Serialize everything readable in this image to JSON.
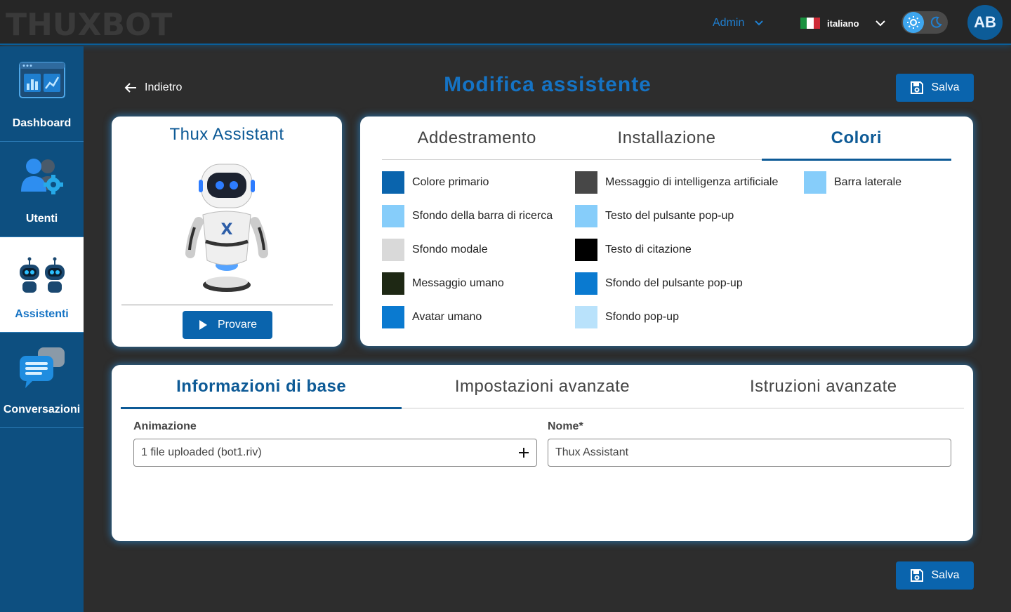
{
  "header": {
    "logo_text": "THUXBOT",
    "admin_label": "Admin",
    "language_label": "italiano",
    "avatar_initials": "AB"
  },
  "sidebar": {
    "items": [
      {
        "label": "Dashboard",
        "icon": "dashboard-chart-icon",
        "active": false
      },
      {
        "label": "Utenti",
        "icon": "users-gear-icon",
        "active": false
      },
      {
        "label": "Assistenti",
        "icon": "robots-icon",
        "active": true
      },
      {
        "label": "Conversazioni",
        "icon": "chat-bubbles-icon",
        "active": false
      }
    ]
  },
  "page": {
    "back_label": "Indietro",
    "title": "Modifica assistente",
    "save_label": "Salva"
  },
  "bot_card": {
    "name": "Thux Assistant",
    "try_label": "Provare"
  },
  "top_tabs": {
    "items": [
      {
        "label": "Addestramento",
        "active": false
      },
      {
        "label": "Installazione",
        "active": false
      },
      {
        "label": "Colori",
        "active": true
      }
    ]
  },
  "colors": {
    "items": [
      {
        "label": "Colore primario",
        "color": "#0a64ad"
      },
      {
        "label": "Sfondo della barra di ricerca",
        "color": "#86cdfa"
      },
      {
        "label": "Sfondo modale",
        "color": "#d9d9d9"
      },
      {
        "label": "Messaggio umano",
        "color": "#1e2814"
      },
      {
        "label": "Avatar umano",
        "color": "#0a7ad0"
      },
      {
        "label": "Messaggio di intelligenza artificiale",
        "color": "#474747"
      },
      {
        "label": "Testo del pulsante pop-up",
        "color": "#86cdfa"
      },
      {
        "label": "Testo di citazione",
        "color": "#000000"
      },
      {
        "label": "Sfondo del pulsante pop-up",
        "color": "#0a7ad0"
      },
      {
        "label": "Sfondo pop-up",
        "color": "#b9e2fb"
      },
      {
        "label": "Barra laterale",
        "color": "#86cdfa"
      }
    ]
  },
  "bottom_tabs": {
    "items": [
      {
        "label": "Informazioni di base",
        "active": true
      },
      {
        "label": "Impostazioni avanzate",
        "active": false
      },
      {
        "label": "Istruzioni avanzate",
        "active": false
      }
    ]
  },
  "form": {
    "animation_label": "Animazione",
    "animation_value": "1 file uploaded (bot1.riv)",
    "name_label": "Nome*",
    "name_value": "Thux Assistant"
  }
}
